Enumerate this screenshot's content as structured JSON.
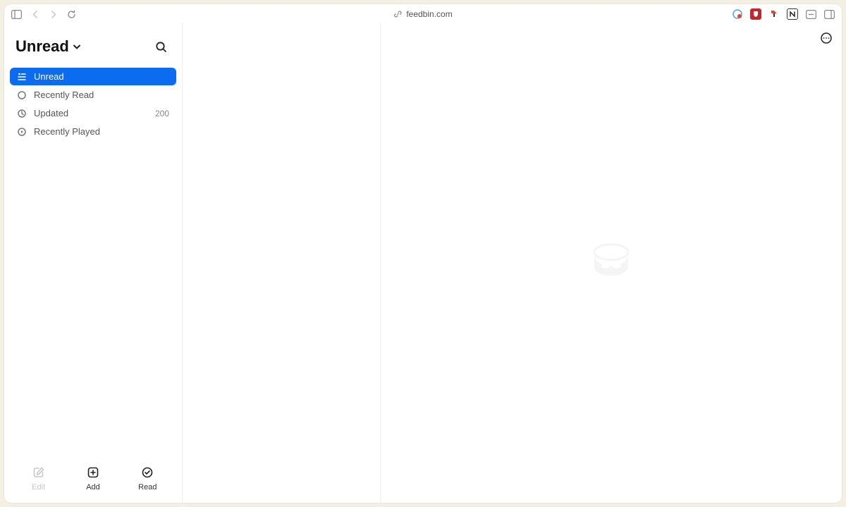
{
  "browser": {
    "url": "feedbin.com"
  },
  "header": {
    "title": "Unread"
  },
  "nav": {
    "items": [
      {
        "label": "Unread",
        "count": ""
      },
      {
        "label": "Recently Read",
        "count": ""
      },
      {
        "label": "Updated",
        "count": "200"
      },
      {
        "label": "Recently Played",
        "count": ""
      }
    ]
  },
  "footer": {
    "edit": "Edit",
    "add": "Add",
    "read": "Read"
  }
}
